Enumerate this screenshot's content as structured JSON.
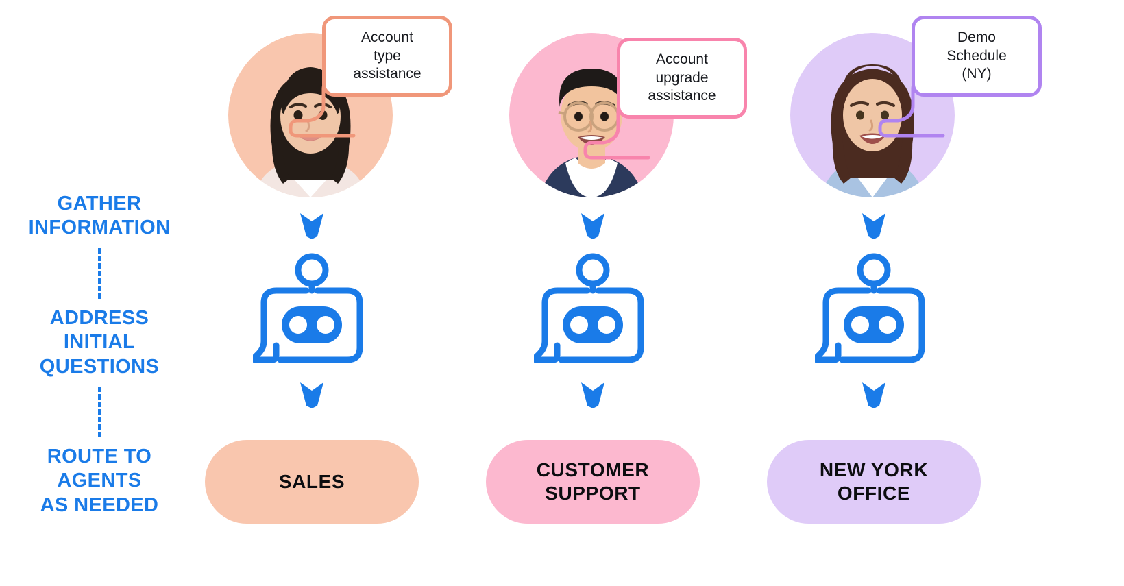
{
  "theme": {
    "accent_blue": "#1A7BE8",
    "background": "#FFFFFF",
    "text_dark": "#0C0D10"
  },
  "stages": [
    {
      "label": "GATHER\nINFORMATION"
    },
    {
      "label": "ADDRESS\nINITIAL\nQUESTIONS"
    },
    {
      "label": "ROUTE TO\nAGENTS\nAS NEEDED"
    }
  ],
  "columns": [
    {
      "avatar": {
        "name": "avatar-woman-dark-hair",
        "circle_color": "#F9C6AE",
        "skin": "#F0C6A8",
        "hair": "#241C17",
        "shirt": "#F3E6E2"
      },
      "bubble": {
        "text": "Account\ntype\nassistance",
        "border_color": "#F0977A"
      },
      "bot": {
        "name": "chatbot-icon",
        "color": "#1A7BE8"
      },
      "pill": {
        "label": "SALES",
        "color": "#F9C6AE"
      }
    },
    {
      "avatar": {
        "name": "avatar-man-glasses",
        "circle_color": "#FCB8CF",
        "skin": "#F2C49E",
        "hair": "#1E1A18",
        "shirt": "#2C3A5C"
      },
      "bubble": {
        "text": "Account\nupgrade\nassistance",
        "border_color": "#F884AC"
      },
      "bot": {
        "name": "chatbot-icon",
        "color": "#1A7BE8"
      },
      "pill": {
        "label": "CUSTOMER\nSUPPORT",
        "color": "#FCB8CF"
      }
    },
    {
      "avatar": {
        "name": "avatar-woman-brown-hair",
        "circle_color": "#DFCBF8",
        "skin": "#EFC6A6",
        "hair": "#4B2B20",
        "shirt": "#A9C3E2"
      },
      "bubble": {
        "text": "Demo\nSchedule\n(NY)",
        "border_color": "#B084F0"
      },
      "bot": {
        "name": "chatbot-icon",
        "color": "#1A7BE8"
      },
      "pill": {
        "label": "NEW YORK\nOFFICE",
        "color": "#DFCBF8"
      }
    }
  ]
}
